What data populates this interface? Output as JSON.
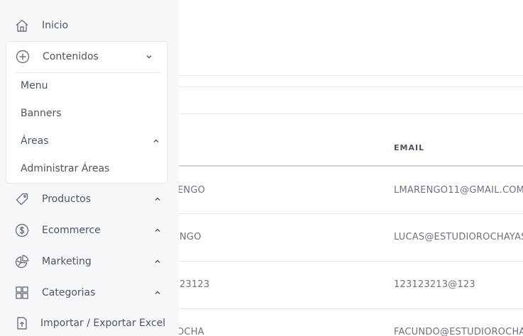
{
  "sidebar": {
    "items": [
      {
        "label": "Inicio",
        "icon": "home-icon"
      },
      {
        "label": "Contenidos",
        "icon": "plus-circle-icon",
        "expanded": true,
        "children": [
          {
            "label": "Menu"
          },
          {
            "label": "Banners"
          },
          {
            "label": "Áreas",
            "expanded": true
          },
          {
            "label": "Administrar Áreas"
          }
        ]
      },
      {
        "label": "Productos",
        "icon": "tag-icon"
      },
      {
        "label": "Ecommerce",
        "icon": "dollar-circle-icon"
      },
      {
        "label": "Marketing",
        "icon": "pie-chart-icon"
      },
      {
        "label": "Categorias",
        "icon": "grid-icon"
      },
      {
        "label": "Importar / Exportar Excel",
        "icon": "file-import-icon"
      }
    ]
  },
  "table": {
    "columns": {
      "email": "EMAIL"
    },
    "rows": [
      {
        "name": "ENGO",
        "email": "LMARENGO11@GMAIL.COM"
      },
      {
        "name": "NGO",
        "email": "LUCAS@ESTUDIOROCHAYAS"
      },
      {
        "name": "23123",
        "email": "123123213@123"
      },
      {
        "name": "OCHA",
        "email": "FACUNDO@ESTUDIOROCHA"
      }
    ]
  },
  "colors": {
    "sidebar_bg": "#f7f8fa",
    "text": "#4b5563",
    "border": "#e5e7eb"
  }
}
